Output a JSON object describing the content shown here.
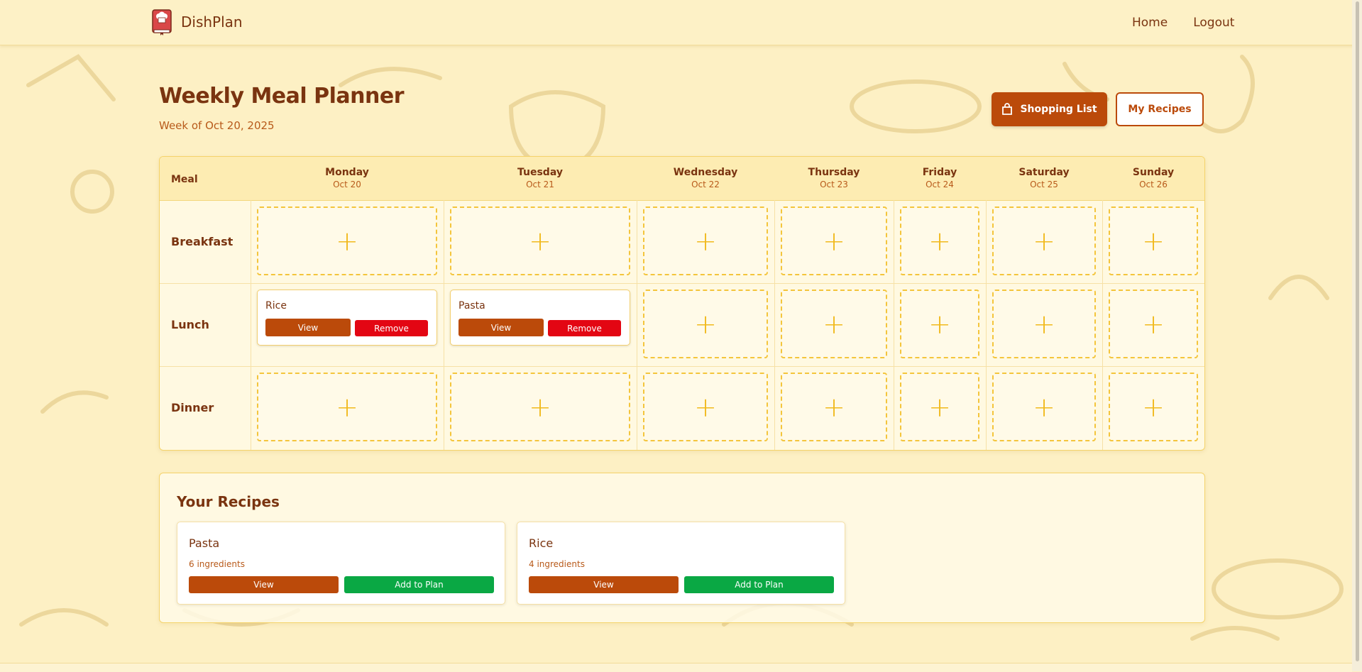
{
  "app": {
    "name": "DishPlan"
  },
  "nav": {
    "home": "Home",
    "logout": "Logout"
  },
  "header": {
    "title": "Weekly Meal Planner",
    "subtitle": "Week of Oct 20, 2025",
    "shopping_label": "Shopping List",
    "myrecipes_label": "My Recipes"
  },
  "planner": {
    "meal_col": "Meal",
    "days": [
      {
        "day": "Monday",
        "date": "Oct 20"
      },
      {
        "day": "Tuesday",
        "date": "Oct 21"
      },
      {
        "day": "Wednesday",
        "date": "Oct 22"
      },
      {
        "day": "Thursday",
        "date": "Oct 23"
      },
      {
        "day": "Friday",
        "date": "Oct 24"
      },
      {
        "day": "Saturday",
        "date": "Oct 25"
      },
      {
        "day": "Sunday",
        "date": "Oct 26"
      }
    ],
    "meals": [
      "Breakfast",
      "Lunch",
      "Dinner"
    ],
    "slot_symbol": "+",
    "entries": {
      "lunch_monday": {
        "title": "Rice",
        "view": "View",
        "remove": "Remove"
      },
      "lunch_tuesday": {
        "title": "Pasta",
        "view": "View",
        "remove": "Remove"
      }
    }
  },
  "recipes": {
    "title": "Your Recipes",
    "items": [
      {
        "name": "Pasta",
        "ingredients": "6 ingredients",
        "view": "View",
        "add": "Add to Plan"
      },
      {
        "name": "Rice",
        "ingredients": "4 ingredients",
        "view": "View",
        "add": "Add to Plan"
      }
    ]
  },
  "colors": {
    "brand_brown": "#bb4a0a",
    "remove_red": "#e30613",
    "add_green": "#0aa844",
    "slot_yellow": "#f4c53c"
  }
}
